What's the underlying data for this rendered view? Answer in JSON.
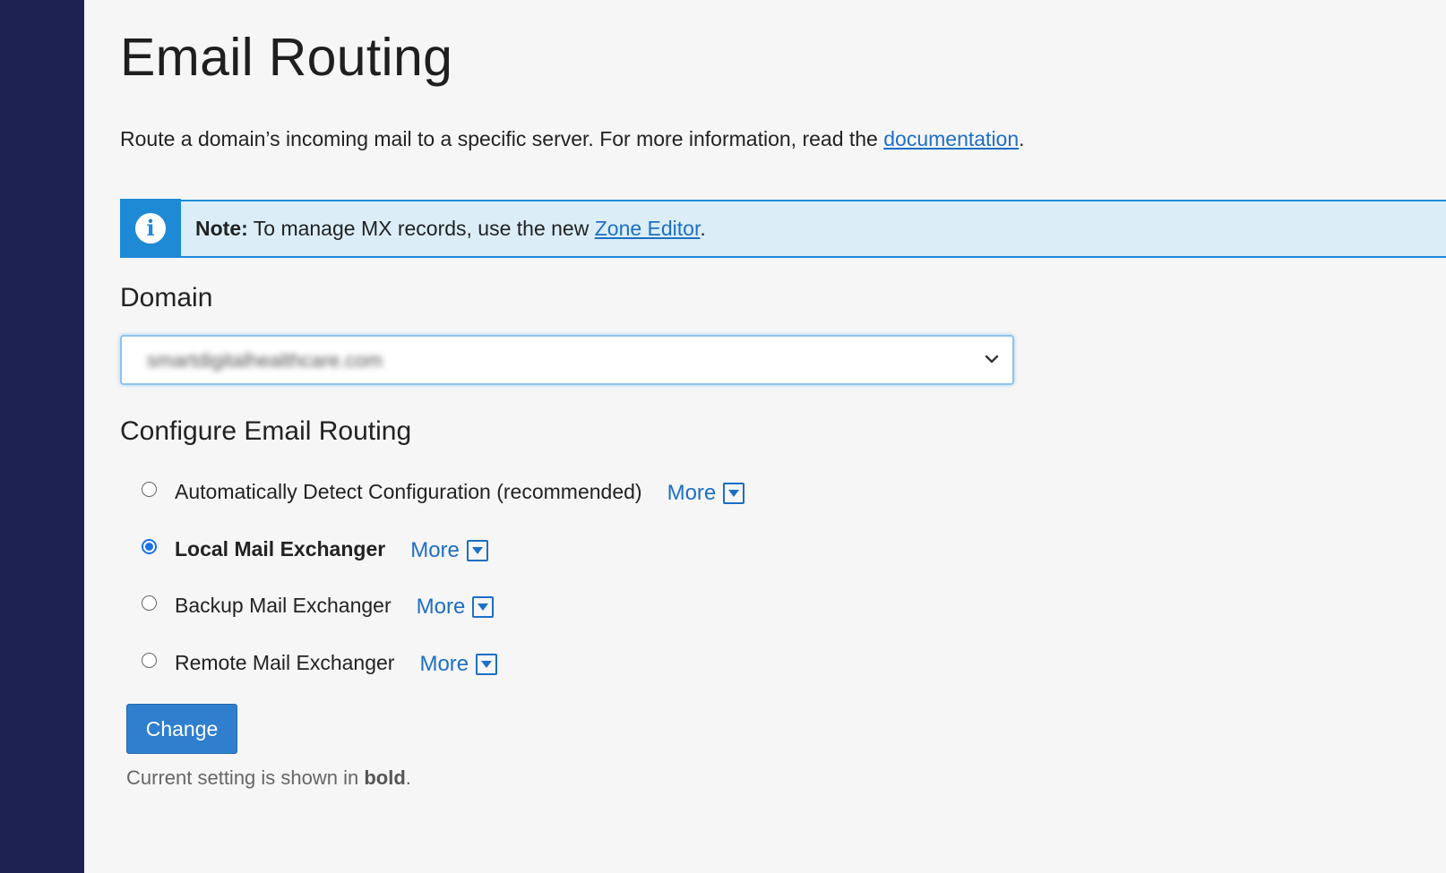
{
  "page": {
    "title": "Email Routing",
    "description_prefix": "Route a domain’s incoming mail to a specific server. For more information, read the ",
    "description_link": "documentation",
    "description_suffix": "."
  },
  "note": {
    "icon": "info-icon",
    "label": "Note:",
    "text_prefix": " To manage MX records, use the new ",
    "link": "Zone Editor",
    "text_suffix": "."
  },
  "domain": {
    "heading": "Domain",
    "selected_value": "smartdigitalhealthcare.com"
  },
  "routing": {
    "heading": "Configure Email Routing",
    "options": [
      {
        "label": "Automatically Detect Configuration (recommended)",
        "more": "More",
        "checked": false
      },
      {
        "label": "Local Mail Exchanger",
        "more": "More",
        "checked": true
      },
      {
        "label": "Backup Mail Exchanger",
        "more": "More",
        "checked": false
      },
      {
        "label": "Remote Mail Exchanger",
        "more": "More",
        "checked": false
      }
    ],
    "submit_label": "Change"
  },
  "footnote": {
    "prefix": "Current setting is shown in ",
    "bold": "bold",
    "suffix": "."
  },
  "colors": {
    "sidebar": "#1e2252",
    "accent": "#1d6fc4",
    "button": "#2f7fce",
    "note_background": "#dbeef8",
    "note_border": "#1e8ad6"
  }
}
